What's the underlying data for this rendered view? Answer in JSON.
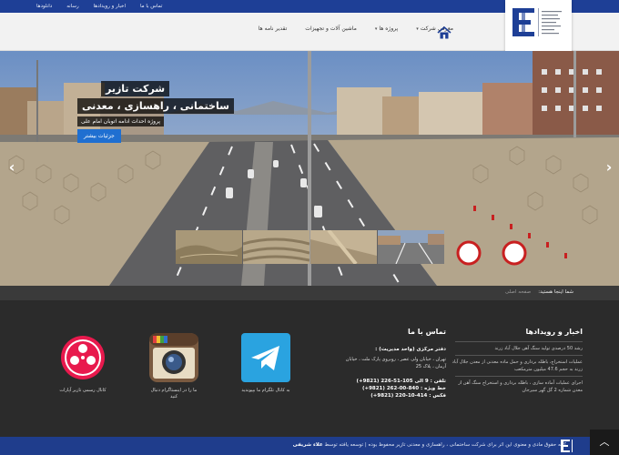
{
  "topnav": [
    "دانلودها",
    "رسانه",
    "اخبار و رویدادها",
    "تماس با ما"
  ],
  "mainnav": [
    {
      "label": "معرفی شرکت",
      "caret": true
    },
    {
      "label": "پروژه ها",
      "caret": true
    },
    {
      "label": "ماشین آلات و تجهیزات",
      "caret": false
    },
    {
      "label": "تقدیر نامه ها",
      "caret": false
    }
  ],
  "hero": {
    "line1": "شرکت تازیر",
    "line2": "ساختمانی ، راهسازی ، معدنی",
    "line3": "پروژه احداث ادامه اتوبان امام علی",
    "button": "جزئیات بیشتر"
  },
  "breadcrumb": {
    "label": "شما اینجا هستید:",
    "link": "صفحه اصلی"
  },
  "news": {
    "title": "اخبار و رویدادها",
    "items": [
      "رشد 50 درصدی تولید سنگ آهن جلال آباد زرند",
      "عملیات استخراج، باطله برداری و حمل ماده معدنی از معدن جلال آباد زرند به حجم 47.6 میلیون مترمکعب",
      "اجرای عملیات آماده سازی ، باطله برداری و استخراج سنگ آهن از معدن شماره 2 گل گهر سیرجان"
    ]
  },
  "contact": {
    "title": "تماس با ما",
    "office": "دفتر مرکزی (واحد مدیریت) :",
    "address": "تهران ، خیابان ولی عصر ، روبروی پارک ملت ، خیابان آرمان ، پلاک 25",
    "phone": "تلفن : 9 الی 105-51-226 (9821+)",
    "line": "خط ویژه : 840-00-262 (9821+)",
    "fax": "فکس : 414-10-220 (9821+)"
  },
  "social": {
    "telegram": "به کانال تلگرام ما بپیوندید",
    "instagram": "ما را در اینستاگرام دنبال کنید",
    "aparat": "کانال رسمی تازیر آپارات"
  },
  "footer": {
    "copyright": "کلیه حقوق مادی و معنوی این اثر برای شرکت ساختمانی ، راهسازی و معدنی تازیر محفوظ بوده | توسعه یافته توسط",
    "developer": "علاء شریفی"
  },
  "colors": {
    "brand_blue": "#1e3f96",
    "button_blue": "#1f6fd1",
    "footer_dark": "#2b2b2b"
  }
}
